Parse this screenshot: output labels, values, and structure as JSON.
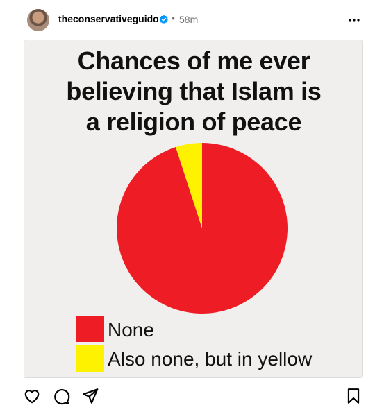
{
  "post": {
    "username": "theconservativeguido",
    "separator": "•",
    "timestamp": "58m"
  },
  "icons": {
    "avatar": "avatar",
    "verified": "verified-badge-icon",
    "more": "more-options-icon",
    "like": "heart-icon",
    "comment": "comment-icon",
    "share": "send-icon",
    "save": "bookmark-icon"
  },
  "colors": {
    "verified": "#0095f6",
    "pie_red": "#ee1c25",
    "pie_yellow": "#fff200",
    "muted_text": "#737373"
  },
  "chart_data": {
    "type": "pie",
    "title": "Chances of me ever believing that Islam is a religion of peace",
    "title_lines": [
      "Chances of me ever",
      "believing that Islam is",
      "a religion of peace"
    ],
    "series": [
      {
        "name": "None",
        "value": 95,
        "color": "#ee1c25"
      },
      {
        "name": "Also none, but in yellow",
        "value": 5,
        "color": "#fff200"
      }
    ],
    "legend": "bottom-left"
  }
}
